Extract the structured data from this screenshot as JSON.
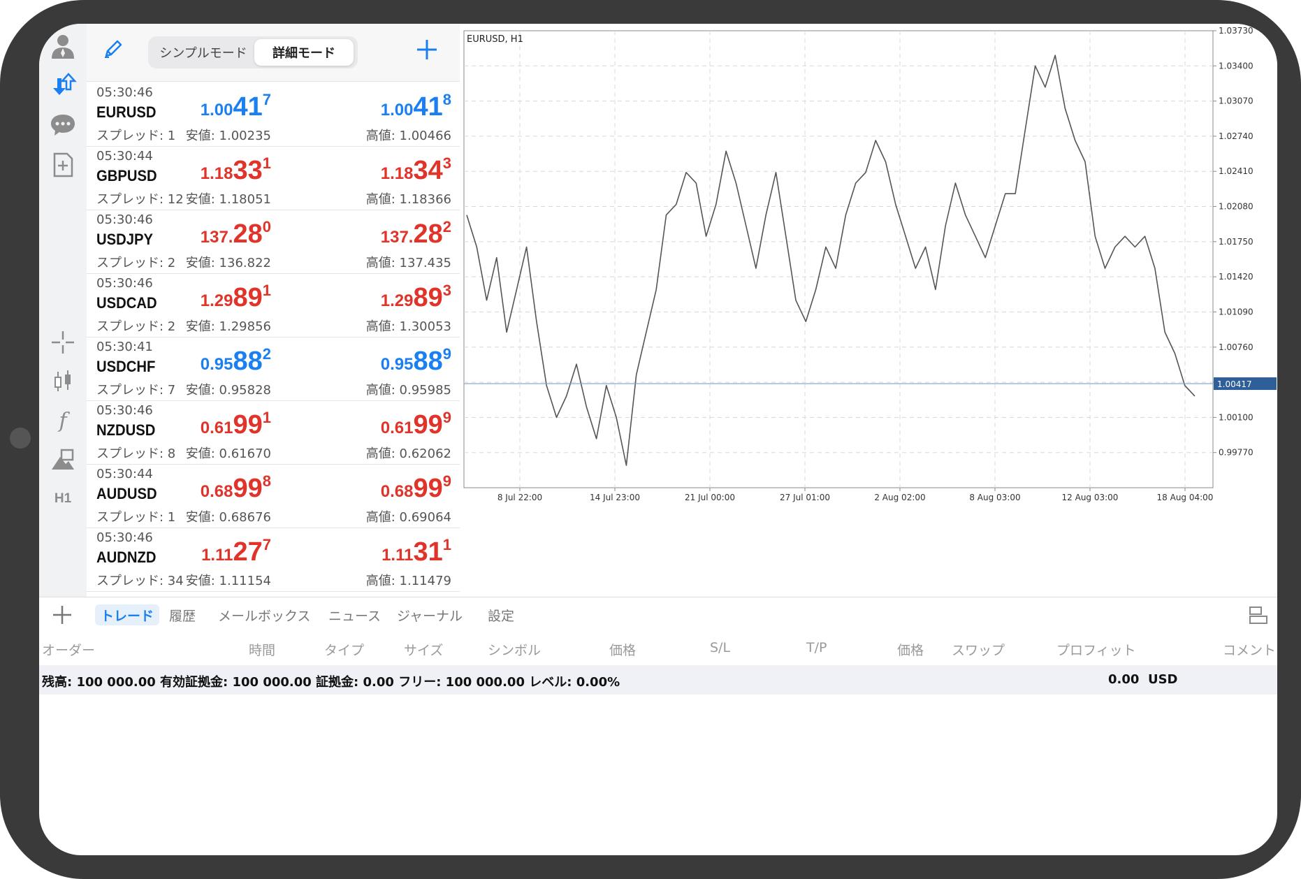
{
  "toolbar": {
    "simple_mode": "シンプルモード",
    "detailed_mode": "詳細モード"
  },
  "quotes": [
    {
      "time": "05:30:46",
      "symbol": "EURUSD",
      "spread": "スプレッド: 1",
      "bid_a": "1.00",
      "bid_b": "41",
      "bid_c": "7",
      "ask_a": "1.00",
      "ask_b": "41",
      "ask_c": "8",
      "low": "安値: 1.00235",
      "high": "高値: 1.00466",
      "color": "blue"
    },
    {
      "time": "05:30:44",
      "symbol": "GBPUSD",
      "spread": "スプレッド: 12",
      "bid_a": "1.18",
      "bid_b": "33",
      "bid_c": "1",
      "ask_a": "1.18",
      "ask_b": "34",
      "ask_c": "3",
      "low": "安値: 1.18051",
      "high": "高値: 1.18366",
      "color": "red"
    },
    {
      "time": "05:30:46",
      "symbol": "USDJPY",
      "spread": "スプレッド: 2",
      "bid_a": "137.",
      "bid_b": "28",
      "bid_c": "0",
      "ask_a": "137.",
      "ask_b": "28",
      "ask_c": "2",
      "low": "安値: 136.822",
      "high": "高値: 137.435",
      "color": "red"
    },
    {
      "time": "05:30:46",
      "symbol": "USDCAD",
      "spread": "スプレッド: 2",
      "bid_a": "1.29",
      "bid_b": "89",
      "bid_c": "1",
      "ask_a": "1.29",
      "ask_b": "89",
      "ask_c": "3",
      "low": "安値: 1.29856",
      "high": "高値: 1.30053",
      "color": "red"
    },
    {
      "time": "05:30:41",
      "symbol": "USDCHF",
      "spread": "スプレッド: 7",
      "bid_a": "0.95",
      "bid_b": "88",
      "bid_c": "2",
      "ask_a": "0.95",
      "ask_b": "88",
      "ask_c": "9",
      "low": "安値: 0.95828",
      "high": "高値: 0.95985",
      "color": "blue"
    },
    {
      "time": "05:30:46",
      "symbol": "NZDUSD",
      "spread": "スプレッド: 8",
      "bid_a": "0.61",
      "bid_b": "99",
      "bid_c": "1",
      "ask_a": "0.61",
      "ask_b": "99",
      "ask_c": "9",
      "low": "安値: 0.61670",
      "high": "高値: 0.62062",
      "color": "red"
    },
    {
      "time": "05:30:44",
      "symbol": "AUDUSD",
      "spread": "スプレッド: 1",
      "bid_a": "0.68",
      "bid_b": "99",
      "bid_c": "8",
      "ask_a": "0.68",
      "ask_b": "99",
      "ask_c": "9",
      "low": "安値: 0.68676",
      "high": "高値: 0.69064",
      "color": "red"
    },
    {
      "time": "05:30:46",
      "symbol": "AUDNZD",
      "spread": "スプレッド: 34",
      "bid_a": "1.11",
      "bid_b": "27",
      "bid_c": "7",
      "ask_a": "1.11",
      "ask_b": "31",
      "ask_c": "1",
      "low": "安値: 1.11154",
      "high": "高値: 1.11479",
      "color": "red"
    }
  ],
  "rail": {
    "timeframe": "H1"
  },
  "chart_data": {
    "type": "line",
    "title": "EURUSD, H1",
    "ylim": [
      0.9944,
      1.0373
    ],
    "y_ticks": [
      "1.03730",
      "1.03400",
      "1.03070",
      "1.02740",
      "1.02410",
      "1.02080",
      "1.01750",
      "1.01420",
      "1.01090",
      "1.00760",
      "1.00430",
      "1.00100",
      "0.99770"
    ],
    "x_ticks": [
      "8 Jul 22:00",
      "14 Jul 23:00",
      "21 Jul 00:00",
      "27 Jul 01:00",
      "2 Aug 02:00",
      "8 Aug 03:00",
      "12 Aug 03:00",
      "18 Aug 04:00"
    ],
    "current_price": "1.00417",
    "current_value": 1.00417,
    "grid": true,
    "series": [
      {
        "values": [
          1.02,
          1.017,
          1.012,
          1.016,
          1.009,
          1.013,
          1.017,
          1.01,
          1.004,
          1.001,
          1.003,
          1.006,
          1.002,
          0.999,
          1.004,
          1.001,
          0.9965,
          1.005,
          1.009,
          1.013,
          1.02,
          1.021,
          1.024,
          1.023,
          1.018,
          1.021,
          1.026,
          1.023,
          1.019,
          1.015,
          1.02,
          1.024,
          1.018,
          1.012,
          1.01,
          1.013,
          1.017,
          1.015,
          1.02,
          1.023,
          1.024,
          1.027,
          1.025,
          1.021,
          1.018,
          1.015,
          1.017,
          1.013,
          1.019,
          1.023,
          1.02,
          1.018,
          1.016,
          1.019,
          1.022,
          1.022,
          1.028,
          1.034,
          1.032,
          1.035,
          1.03,
          1.027,
          1.025,
          1.018,
          1.015,
          1.017,
          1.018,
          1.017,
          1.018,
          1.015,
          1.009,
          1.007,
          1.004,
          1.003
        ]
      }
    ]
  },
  "terminal": {
    "tabs": [
      "トレード",
      "履歴",
      "メールボックス",
      "ニュース",
      "ジャーナル",
      "設定"
    ],
    "columns": [
      "オーダー",
      "時間",
      "タイプ",
      "サイズ",
      "シンボル",
      "価格",
      "S/L",
      "T/P",
      "価格",
      "スワップ",
      "プロフィット",
      "コメント"
    ],
    "balance_text": "残高: 100 000.00 有効証拠金: 100 000.00 証拠金: 0.00 フリー: 100 000.00 レベル: 0.00%",
    "profit": "0.00",
    "currency": "USD"
  }
}
